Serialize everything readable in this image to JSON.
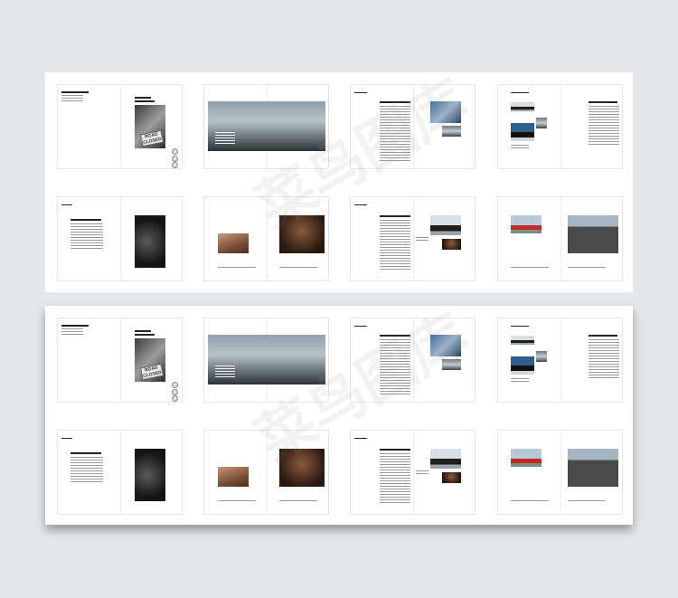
{
  "watermark": {
    "text": "菜鸟图库"
  },
  "spreads": {
    "cover_sign": {
      "line1": "ROAD",
      "line2": "CLOSED"
    }
  },
  "colors": {
    "background": "#e3e8ea",
    "sheet": "#ffffff"
  }
}
